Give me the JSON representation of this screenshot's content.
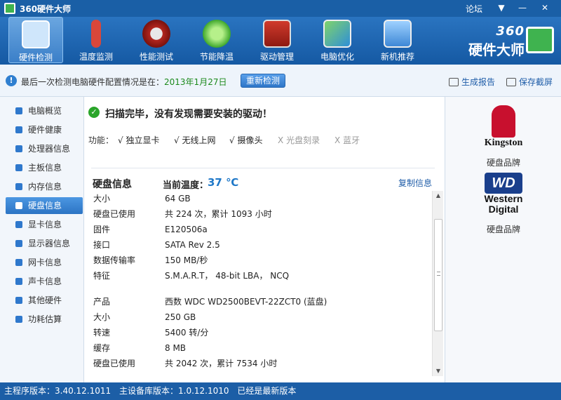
{
  "app": {
    "title": "360硬件大师",
    "forum": "论坛",
    "brand_number": "360",
    "brand_name": "硬件大师"
  },
  "toolbar": {
    "items": [
      {
        "label": "硬件检测",
        "icon": "monitor-magnifier-icon"
      },
      {
        "label": "温度监测",
        "icon": "thermometer-icon"
      },
      {
        "label": "性能测试",
        "icon": "speedometer-icon"
      },
      {
        "label": "节能降温",
        "icon": "clover-icon"
      },
      {
        "label": "驱动管理",
        "icon": "toolbox-icon"
      },
      {
        "label": "电脑优化",
        "icon": "monitor-broom-icon"
      },
      {
        "label": "新机推荐",
        "icon": "computer-award-icon"
      }
    ],
    "active_index": 0
  },
  "infobar": {
    "text": "最后一次检测电脑硬件配置情况是在：",
    "date": "2013年1月27日",
    "recheck": "重新检测",
    "report": "生成报告",
    "save": "保存截屏"
  },
  "sidebar": {
    "items": [
      "电脑概览",
      "硬件健康",
      "处理器信息",
      "主板信息",
      "内存信息",
      "硬盘信息",
      "显卡信息",
      "显示器信息",
      "网卡信息",
      "声卡信息",
      "其他硬件",
      "功耗估算"
    ],
    "active_index": 5
  },
  "main": {
    "scan_result": "扫描完毕，没有发现需要安装的驱动！",
    "features_label": "功能：",
    "features": [
      {
        "mark": "√",
        "label": "独立显卡",
        "ok": true
      },
      {
        "mark": "√",
        "label": "无线上网",
        "ok": true
      },
      {
        "mark": "√",
        "label": "摄像头",
        "ok": true
      },
      {
        "mark": "X",
        "label": "光盘刻录",
        "ok": false
      },
      {
        "mark": "X",
        "label": "蓝牙",
        "ok": false
      }
    ],
    "disk_title": "硬盘信息",
    "temp_label": "当前温度：",
    "temp_value": "37 ℃",
    "copy": "复制信息",
    "rows": [
      {
        "key": "大小",
        "value": "64 GB"
      },
      {
        "key": "硬盘已使用",
        "value": "共 224 次，累计 1093 小时"
      },
      {
        "key": "固件",
        "value": "E120506a"
      },
      {
        "key": "接口",
        "value": "SATA Rev 2.5"
      },
      {
        "key": "数据传输率",
        "value": "150 MB/秒"
      },
      {
        "key": "特征",
        "value": "S.M.A.R.T，  48-bit LBA，  NCQ"
      },
      {
        "key": "产品",
        "value": "西数 WDC WD2500BEVT-22ZCT0 (蓝盘)"
      },
      {
        "key": "大小",
        "value": "250 GB"
      },
      {
        "key": "转速",
        "value": "5400 转/分"
      },
      {
        "key": "缓存",
        "value": "8 MB"
      },
      {
        "key": "硬盘已使用",
        "value": "共 2042 次，累计 7534 小时"
      }
    ]
  },
  "right_panel": {
    "brands": [
      {
        "logo_text": "Kingston",
        "caption": "硬盘品牌"
      },
      {
        "logo_text_top": "WD",
        "logo_text_line1": "Western",
        "logo_text_line2": "Digital",
        "caption": "硬盘品牌"
      }
    ]
  },
  "footer": {
    "program_version": "主程序版本：3.40.12.1011",
    "db_version": "主设备库版本：1.0.12.1010",
    "status": "已经是最新版本"
  }
}
